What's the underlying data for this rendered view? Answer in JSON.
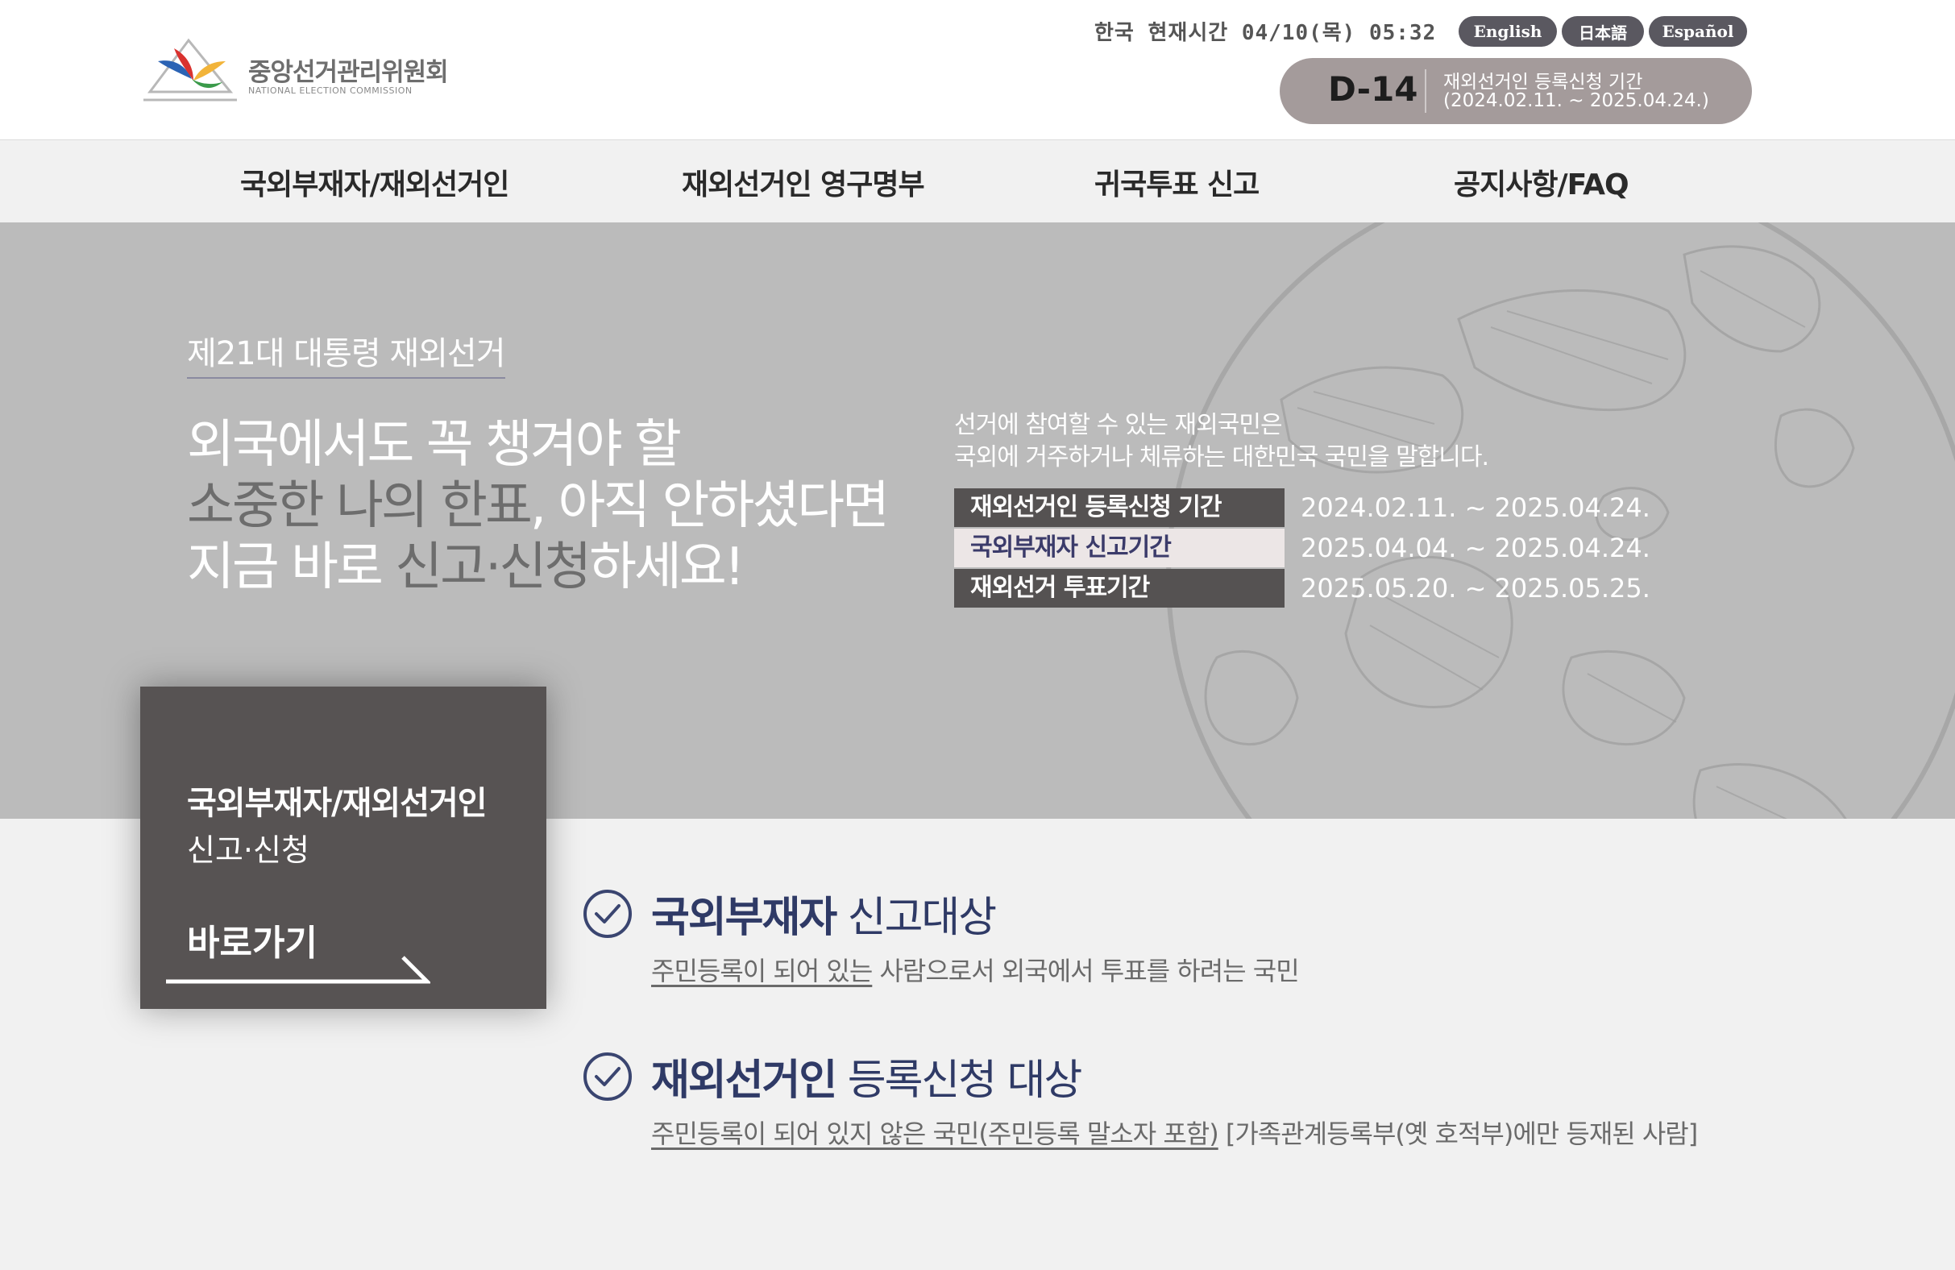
{
  "header": {
    "logo": {
      "name_ko": "중앙선거관리위원회",
      "name_en": "NATIONAL ELECTION COMMISSION"
    },
    "clock": "한국 현재시간 04/10(목) 05:32",
    "languages": [
      "English",
      "日本語",
      "Español"
    ],
    "dday": {
      "count": "D-14",
      "label": "재외선거인 등록신청 기간",
      "range": "(2024.02.11. ~ 2025.04.24.)"
    }
  },
  "nav": {
    "items": [
      "국외부재자/재외선거인",
      "재외선거인 영구명부",
      "귀국투표 신고",
      "공지사항/FAQ"
    ]
  },
  "hero": {
    "subtitle": "제21대 대통령 재외선거",
    "line1": "외국에서도 꼭 챙겨야 할",
    "line2_a": "소중한 나의 한표",
    "line2_b": ", 아직 안하셨다면",
    "line3_a": "지금 바로 ",
    "line3_b": "신고·신청",
    "line3_c": "하세요!",
    "desc1": "선거에 참여할 수 있는 재외국민은",
    "desc2": "국외에 거주하거나 체류하는 대한민국 국민을 말합니다.",
    "periods": [
      {
        "label": "재외선거인 등록신청 기간",
        "dates": "2024.02.11. ~ 2025.04.24."
      },
      {
        "label": "국외부재자 신고기간",
        "dates": "2025.04.04. ~ 2025.04.24."
      },
      {
        "label": "재외선거 투표기간",
        "dates": "2025.05.20. ~ 2025.05.25."
      }
    ]
  },
  "cta": {
    "title": "국외부재자/재외선거인",
    "subtitle": "신고·신청",
    "link": "바로가기"
  },
  "info": [
    {
      "title_bold": "국외부재자",
      "title_rest": " 신고대상",
      "desc_underlined": "주민등록이 되어 있는",
      "desc_rest": " 사람으로서 외국에서 투표를 하려는 국민"
    },
    {
      "title_bold": "재외선거인",
      "title_rest": " 등록신청 대상",
      "desc_underlined": "주민등록이 되어 있지 않은 국민(주민등록 말소자 포함)",
      "desc_rest": " [가족관계등록부(옛 호적부)에만 등재된 사람]"
    }
  ],
  "colors": {
    "hero_bg": "#bbbbbb",
    "cta_bg": "#575353",
    "accent_navy": "#2f3a66",
    "lang_button": "#5a5860",
    "dday_pill": "#a49b9b"
  },
  "icons": {
    "logo": "nec-logo-icon",
    "check": "check-circle-icon",
    "arrow": "arrow-right-icon",
    "globe": "globe-illustration"
  }
}
